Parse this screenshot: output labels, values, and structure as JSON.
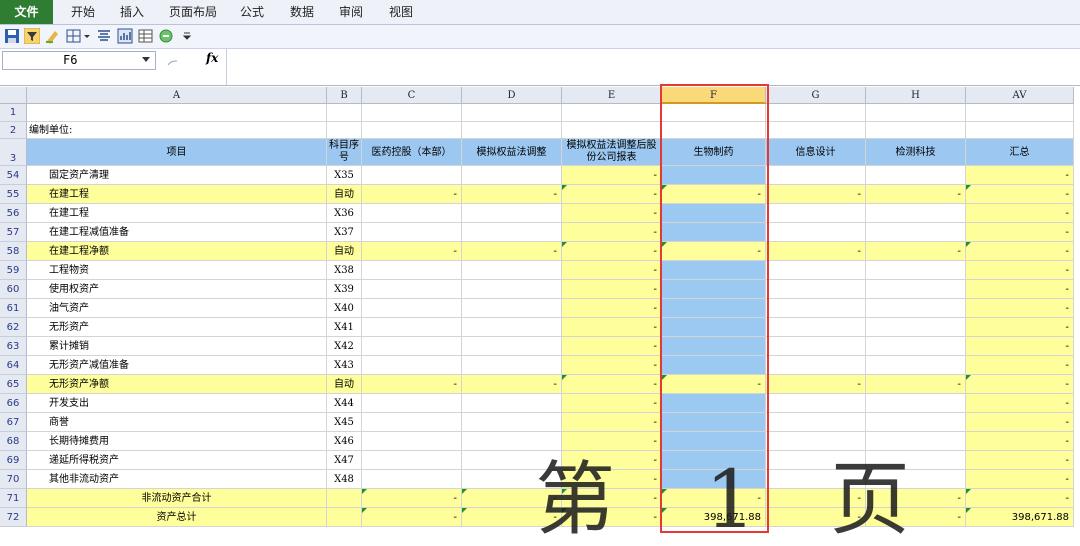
{
  "menu": {
    "file": "文件",
    "tabs": [
      "开始",
      "插入",
      "页面布局",
      "公式",
      "数据",
      "审阅",
      "视图"
    ]
  },
  "formula_bar": {
    "name_box": "F6",
    "fx": "fx",
    "formula": ""
  },
  "columns": [
    "A",
    "B",
    "C",
    "D",
    "E",
    "F",
    "G",
    "H",
    "AV"
  ],
  "selected_column": "F",
  "row1": "",
  "row2_a": "编制单位:",
  "header_row": {
    "num": "3",
    "a": "项目",
    "b": "科目序号",
    "c": "医药控股（本部）",
    "d": "模拟权益法调整",
    "e": "模拟权益法调整后股份公司报表",
    "f": "生物制药",
    "g": "信息设计",
    "h": "检测科技",
    "av": "汇总"
  },
  "rows": [
    {
      "num": "54",
      "a": "固定资产清理",
      "b": "X35",
      "kind": "input"
    },
    {
      "num": "55",
      "a": "在建工程",
      "b": "自动",
      "kind": "auto"
    },
    {
      "num": "56",
      "a": "在建工程",
      "b": "X36",
      "kind": "input"
    },
    {
      "num": "57",
      "a": "在建工程减值准备",
      "b": "X37",
      "kind": "input"
    },
    {
      "num": "58",
      "a": "在建工程净额",
      "b": "自动",
      "kind": "auto"
    },
    {
      "num": "59",
      "a": "工程物资",
      "b": "X38",
      "kind": "input"
    },
    {
      "num": "60",
      "a": "使用权资产",
      "b": "X39",
      "kind": "input"
    },
    {
      "num": "61",
      "a": "油气资产",
      "b": "X40",
      "kind": "input"
    },
    {
      "num": "62",
      "a": "无形资产",
      "b": "X41",
      "kind": "input"
    },
    {
      "num": "63",
      "a": "累计摊销",
      "b": "X42",
      "kind": "input"
    },
    {
      "num": "64",
      "a": "无形资产减值准备",
      "b": "X43",
      "kind": "input"
    },
    {
      "num": "65",
      "a": "无形资产净额",
      "b": "自动",
      "kind": "auto"
    },
    {
      "num": "66",
      "a": "开发支出",
      "b": "X44",
      "kind": "input"
    },
    {
      "num": "67",
      "a": "商誉",
      "b": "X45",
      "kind": "input"
    },
    {
      "num": "68",
      "a": "长期待摊费用",
      "b": "X46",
      "kind": "input"
    },
    {
      "num": "69",
      "a": "递延所得税资产",
      "b": "X47",
      "kind": "input"
    },
    {
      "num": "70",
      "a": "其他非流动资产",
      "b": "X48",
      "kind": "input"
    },
    {
      "num": "71",
      "a": "非流动资产合计",
      "b": "",
      "kind": "total"
    },
    {
      "num": "72",
      "a": "资产总计",
      "b": "",
      "kind": "grand",
      "f": "398,671.88",
      "av": "398,671.88"
    }
  ],
  "dash": "-",
  "watermark": [
    "第",
    "1",
    "页"
  ],
  "colors": {
    "yellow": "#fefe9a",
    "blue": "#9cc9f1",
    "header_blue": "#9bc7f0",
    "highlight": "#e53935",
    "file_tab": "#2e7d32"
  }
}
